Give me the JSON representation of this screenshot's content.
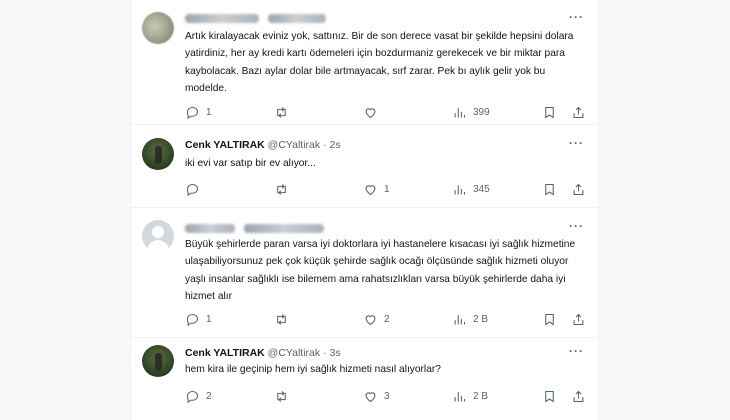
{
  "tweets": [
    {
      "name": "",
      "handle": "",
      "time": "",
      "text": "Artık kiralayacak eviniz yok, sattınız. Bir de son derece vasat bir şekilde hepsini dolara yatirdiniz, her ay kredi kartı ödemeleri için bozdurmaniz gerekecek ve bir miktar para kaybolacak. Bazı aylar dolar bile artmayacak, sırf zarar. Pek bı aylık gelir yok bu modelde.",
      "replies": "1",
      "retweets": "",
      "likes": "",
      "views": "399"
    },
    {
      "name": "Cenk YALTIRAK",
      "handle": "@CYaltirak",
      "time": "· 2s",
      "text": "iki evi var satıp bir ev alıyor...",
      "replies": "",
      "retweets": "",
      "likes": "1",
      "views": "345"
    },
    {
      "name": "",
      "handle": "",
      "time": "",
      "text": "Büyük şehirlerde paran varsa iyi doktorlara iyi hastanelere kısacası iyi sağlık hizmetine ulaşabiliyorsunuz pek çok küçük şehirde sağlık ocağı ölçüsünde sağlık hizmeti oluyor yaşlı insanlar sağlıklı ise bilemem ama rahatsızlıkları varsa büyük şehirlerde daha iyi hizmet alır",
      "replies": "1",
      "retweets": "",
      "likes": "2",
      "views": "2 B"
    },
    {
      "name": "Cenk YALTIRAK",
      "handle": "@CYaltirak",
      "time": "· 3s",
      "text": "hem kira ile geçinip hem iyi sağlık hizmeti nasıl alıyorlar?",
      "replies": "2",
      "retweets": "",
      "likes": "3",
      "views": "2 B"
    }
  ],
  "icons": {
    "reply": "reply-icon",
    "retweet": "retweet-icon",
    "like": "like-icon",
    "views": "views-icon",
    "bookmark": "bookmark-icon",
    "share": "share-icon",
    "more": "more-icon"
  },
  "colors": {
    "text": "#0f1419",
    "secondary": "#536471",
    "border": "#eff3f4",
    "background": "#ffffff",
    "page": "#f7f9f9"
  }
}
